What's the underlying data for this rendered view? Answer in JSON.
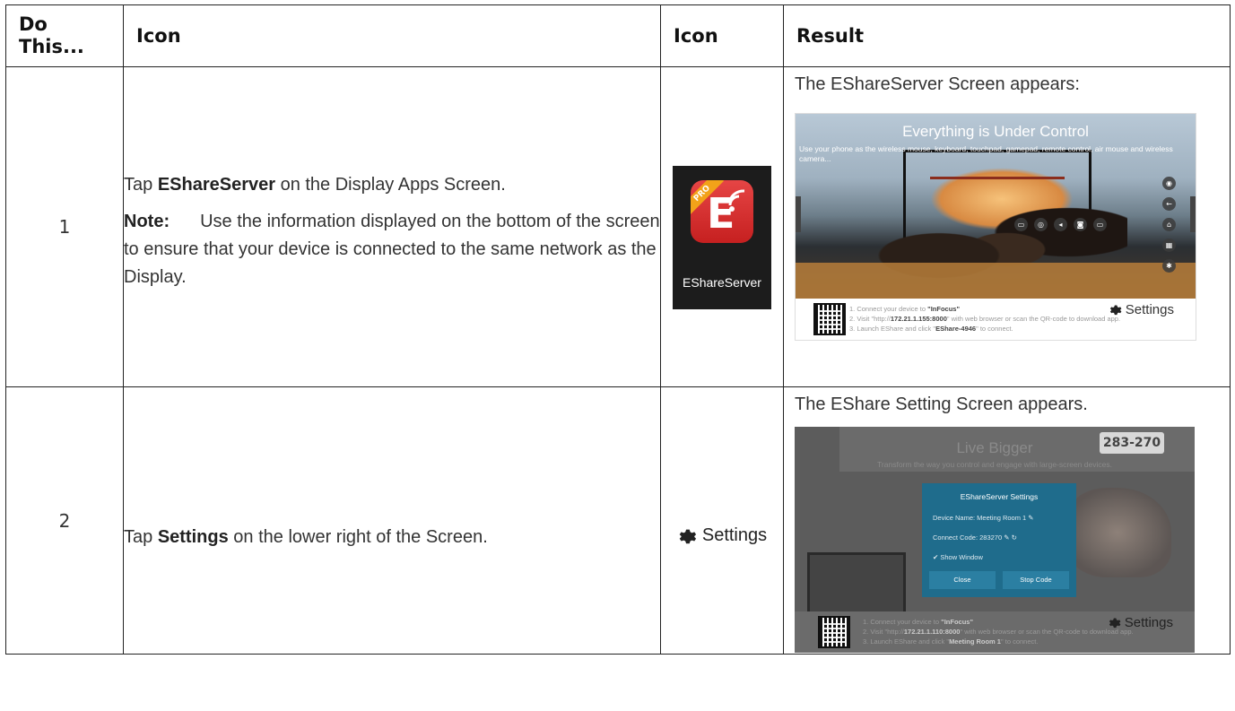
{
  "table": {
    "headers": [
      "Do This...",
      "Icon",
      "Icon",
      "Result"
    ],
    "rows": [
      {
        "step": "1",
        "desc_pre": "Tap ",
        "desc_bold": "EShareServer",
        "desc_post": " on the Display Apps Screen.",
        "note_label": "Note:",
        "note_text": "Use the information displayed on the bottom of the screen to  ensure that your device is connected to the same network as the Display.",
        "icon": {
          "name": "EShareServer",
          "ribbon": "PRO",
          "letter": "E"
        },
        "result_text": "The EShareServer Screen appears:",
        "screenshot": {
          "headline": "Everything is Under Control",
          "subline": "Use your phone as the wireless mouse, keyboard, touchpad, gamepad, remote control, air mouse and wireless camera...",
          "footer_line1_pre": "1. Connect your device to ",
          "footer_line1_bold": "\"InFocus\"",
          "footer_line2_pre": "2. Visit \"http://",
          "footer_line2_bold": "172.21.1.155:8000",
          "footer_line2_post": "\" with web browser or scan the QR-code to download app.",
          "footer_line3_pre": "3. Launch EShare and click \"",
          "footer_line3_bold": "EShare-4946",
          "footer_line3_post": "\" to connect.",
          "settings_label": "Settings"
        }
      },
      {
        "step": "2",
        "desc_pre": "Tap ",
        "desc_bold": "Settings",
        "desc_post": " on the lower right of the Screen.",
        "icon": {
          "name": "Settings"
        },
        "result_text": "The EShare Setting Screen appears.",
        "screenshot": {
          "headline": "Live Bigger",
          "subline": "Transform the way you control and engage with large-screen devices.",
          "code": "283-270",
          "dialog_title": "EShareServer Settings",
          "device_name": "Device Name: Meeting  Room 1",
          "connect_code": "Connect Code: 283270",
          "show_window": "Show Window",
          "close_label": "Close",
          "stop_label": "Stop Code",
          "footer_line1_pre": "1. Connect your device to ",
          "footer_line1_bold": "\"InFocus\"",
          "footer_line2_pre": "2. Visit \"http://",
          "footer_line2_bold": "172.21.1.110:8000",
          "footer_line2_post": "\" with web browser or scan the QR-code to download app.",
          "footer_line3_pre": "3. Launch EShare and click \"",
          "footer_line3_bold": "Meeting Room 1",
          "footer_line3_post": "\" to connect.",
          "settings_label": "Settings"
        }
      }
    ]
  },
  "icons": [
    "gear-icon",
    "cast-icon",
    "home-icon",
    "back-icon",
    "qr-code-icon"
  ]
}
